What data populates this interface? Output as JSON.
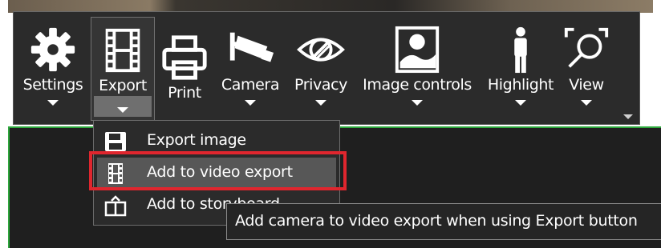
{
  "toolbar": {
    "tools": [
      {
        "label": "Settings",
        "icon": "gear-icon"
      },
      {
        "label": "Export",
        "icon": "film-strip-icon",
        "active": true
      },
      {
        "label": "Print",
        "icon": "printer-icon"
      },
      {
        "label": "Camera",
        "icon": "security-camera-icon"
      },
      {
        "label": "Privacy",
        "icon": "eye-slash-icon"
      },
      {
        "label": "Image controls",
        "icon": "image-icon"
      },
      {
        "label": "Highlight",
        "icon": "person-icon"
      },
      {
        "label": "View",
        "icon": "magnify-icon"
      }
    ],
    "overflow_icon": "overflow-arrow-icon"
  },
  "export_menu": {
    "items": [
      {
        "label": "Export image",
        "icon": "save-icon"
      },
      {
        "label": "Add to video export",
        "icon": "film-strip-icon",
        "highlighted": true
      },
      {
        "label": "Add to storyboard",
        "icon": "storyboard-icon"
      }
    ]
  },
  "tooltip": {
    "text": "Add camera to video export when using Export button"
  },
  "colors": {
    "toolbar_bg": "#2b2b2b",
    "highlight_box": "#e0262e",
    "viewport_border": "#2ea83d",
    "hover_bg": "#575757"
  }
}
